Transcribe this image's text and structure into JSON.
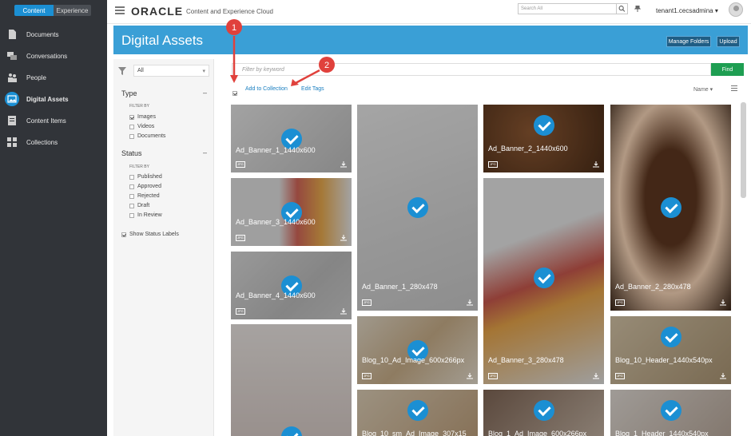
{
  "sidebar": {
    "tabs": [
      {
        "label": "Content"
      },
      {
        "label": "Experience"
      }
    ],
    "items": [
      {
        "label": "Documents",
        "icon": "document-icon"
      },
      {
        "label": "Conversations",
        "icon": "conversations-icon"
      },
      {
        "label": "People",
        "icon": "people-icon"
      },
      {
        "label": "Digital Assets",
        "icon": "image-icon",
        "active": true
      },
      {
        "label": "Content Items",
        "icon": "content-items-icon"
      },
      {
        "label": "Collections",
        "icon": "collections-icon"
      }
    ]
  },
  "header": {
    "logo": "ORACLE",
    "subtitle": "Content and Experience Cloud",
    "search_placeholder": "Search All",
    "user": "tenant1.cecsadmina"
  },
  "banner": {
    "title": "Digital Assets",
    "manage_folders": "Manage Folders",
    "upload": "Upload"
  },
  "filters": {
    "scope": "All",
    "type_heading": "Type",
    "status_heading": "Status",
    "filter_by": "FILTER BY",
    "collapse": "–",
    "type_options": [
      {
        "label": "Images",
        "checked": true
      },
      {
        "label": "Videos",
        "checked": false
      },
      {
        "label": "Documents",
        "checked": false
      }
    ],
    "status_options": [
      {
        "label": "Published",
        "checked": false
      },
      {
        "label": "Approved",
        "checked": false
      },
      {
        "label": "Rejected",
        "checked": false
      },
      {
        "label": "Draft",
        "checked": false
      },
      {
        "label": "In Review",
        "checked": false
      }
    ],
    "show_status_labels": "Show Status Labels"
  },
  "toolbar": {
    "keyword_placeholder": "Filter by keyword",
    "find": "Find",
    "add_to_collection": "Add to Collection",
    "edit_tags": "Edit Tags",
    "sort": "Name"
  },
  "annotations": [
    "1",
    "2"
  ],
  "assets": [
    {
      "name": "Ad_Banner_1_1440x600",
      "type": "JPG"
    },
    {
      "name": "Ad_Banner_3_1440x600",
      "type": "JPG"
    },
    {
      "name": "Ad_Banner_4_1440x600",
      "type": "JPG"
    },
    {
      "name": "Ad_Banner_1_280x478",
      "type": "JPG"
    },
    {
      "name": "Blog_10_Ad_Image_600x266px",
      "type": "JPG"
    },
    {
      "name": "Blog_10_sm_Ad_Image_307x15"
    },
    {
      "name": "Ad_Banner_2_1440x600",
      "type": "JPG"
    },
    {
      "name": "Ad_Banner_3_280x478",
      "type": "JPG"
    },
    {
      "name": "Blog_1_Ad_Image_600x266px"
    },
    {
      "name": "Ad_Banner_2_280x478",
      "type": "JPG"
    },
    {
      "name": "Blog_10_Header_1440x540px",
      "type": "JPG"
    },
    {
      "name": "Blog_1_Header_1440x540px"
    }
  ],
  "colors": {
    "brand": "#3a9fd6",
    "sidebar": "#313439",
    "select": "#1b8fd3",
    "find": "#1e9e52",
    "annotation": "#e0413c"
  }
}
